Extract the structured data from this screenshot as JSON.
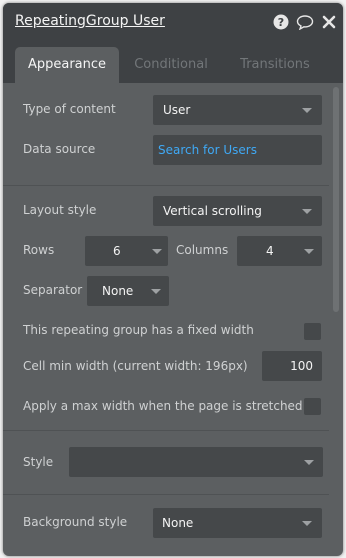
{
  "header": {
    "title": "RepeatingGroup User",
    "help_icon": "question-circle-icon",
    "comment_icon": "speech-bubble-icon",
    "close_icon": "close-icon"
  },
  "tabs": [
    {
      "label": "Appearance",
      "active": true
    },
    {
      "label": "Conditional",
      "active": false
    },
    {
      "label": "Transitions",
      "active": false
    }
  ],
  "fields": {
    "type_of_content": {
      "label": "Type of content",
      "value": "User"
    },
    "data_source": {
      "label": "Data source",
      "value": "Search for Users"
    },
    "layout_style": {
      "label": "Layout style",
      "value": "Vertical scrolling"
    },
    "rows": {
      "label": "Rows",
      "value": "6"
    },
    "columns": {
      "label": "Columns",
      "value": "4"
    },
    "separator": {
      "label": "Separator",
      "value": "None"
    },
    "fixed_width": {
      "label": "This repeating group has a fixed width",
      "checked": false
    },
    "cell_min_width": {
      "label": "Cell min width (current width: 196px)",
      "value": "100"
    },
    "max_width": {
      "label": "Apply a max width when the page is stretched",
      "checked": false
    },
    "style": {
      "label": "Style",
      "value": ""
    },
    "background_style": {
      "label": "Background style",
      "value": "None"
    }
  },
  "colors": {
    "panel": "#5c5f61",
    "header": "#3e4144",
    "input": "#45484a",
    "link": "#3fa9f5",
    "label": "#cfd1d2"
  }
}
